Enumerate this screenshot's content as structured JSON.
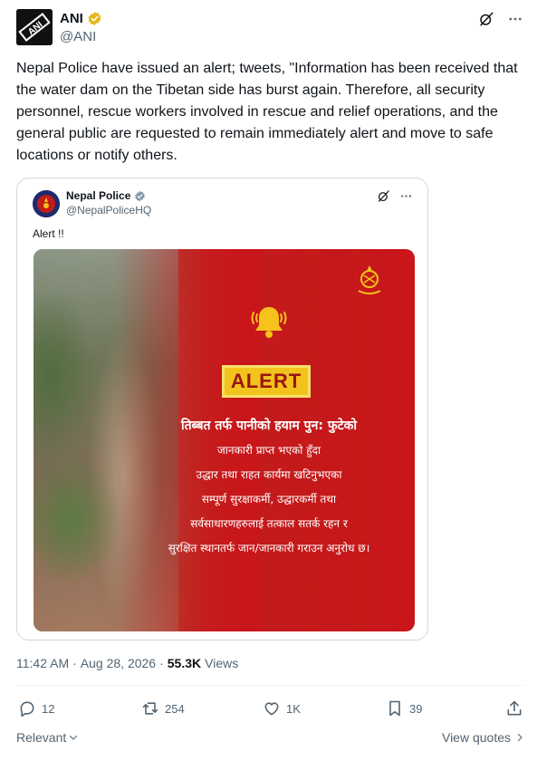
{
  "tweet": {
    "author_name": "ANI",
    "author_handle": "@ANI",
    "avatar_text": "ANI",
    "text": "Nepal Police have issued an alert; tweets, \"Information has been received that the water dam on the Tibetan side has burst again. Therefore, all security personnel, rescue workers involved in rescue and relief operations, and the general public are requested to remain immediately alert and move to safe locations or notify others.",
    "time": "11:42 AM",
    "date": "Aug 28, 2026",
    "views_count": "55.3K",
    "views_label": "Views"
  },
  "quote": {
    "author_name": "Nepal Police",
    "author_handle": "@NepalPoliceHQ",
    "text": "Alert !!",
    "image": {
      "alert_label": "ALERT",
      "lines": [
        "तिब्बत तर्फ पानीको हयाम पुन: फुटेको",
        "जानकारी प्राप्त भएको हुँदा",
        "उद्धार तथा राहत कार्यमा खटिनुभएका",
        "सम्पूर्ण सुरक्षाकर्मी, उद्धारकर्मी तथा",
        "सर्वसाधारणहरुलाई तत्काल सतर्क रहन र",
        "सुरक्षित स्थानतर्फ जान/जानकारी गराउन अनुरोध छ।"
      ]
    }
  },
  "actions": {
    "replies": "12",
    "reposts": "254",
    "likes": "1K",
    "bookmarks": "39"
  },
  "footer": {
    "sort_label": "Relevant",
    "view_quotes_label": "View quotes"
  },
  "colors": {
    "verified": "#e2b719",
    "alert_red": "#c9161a",
    "alert_yellow": "#f2c31c",
    "muted_text": "#536471"
  },
  "icons": {
    "verified": "verified-badge-icon",
    "grok": "grok-icon",
    "more": "more-icon",
    "reply": "reply-icon",
    "repost": "repost-icon",
    "like": "heart-icon",
    "bookmark": "bookmark-icon",
    "share": "share-icon",
    "bell": "bell-icon"
  }
}
